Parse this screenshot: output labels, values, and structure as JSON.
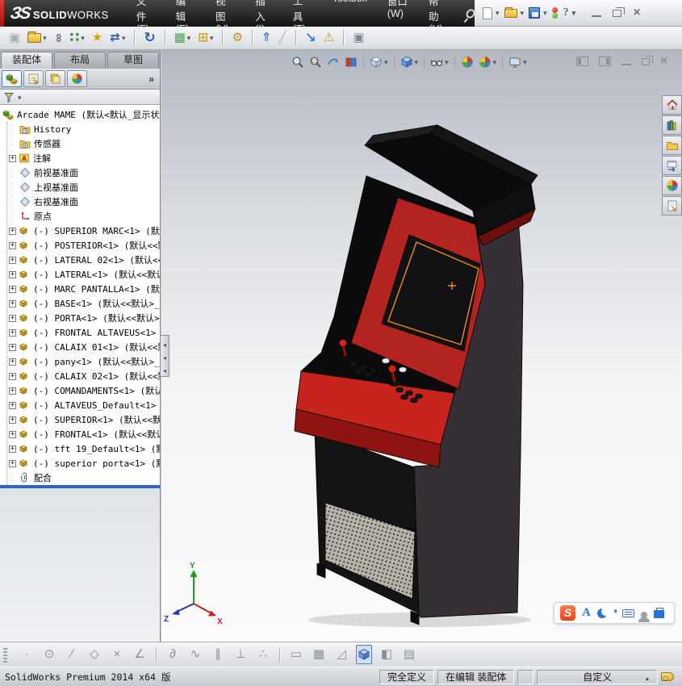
{
  "window": {
    "brand_mark": "ЗS",
    "brand_solid": "SOLID",
    "brand_works": "WORKS",
    "menus": [
      "文件(F)",
      "编辑(E)",
      "视图(V)",
      "插入(I)",
      "工具(T)",
      "Toolbox",
      "窗口(W)",
      "帮助(H)"
    ]
  },
  "toolbar": {
    "icons": [
      "insert-component",
      "open-document",
      "mate",
      "linear-component-pattern",
      "smart-fasteners",
      "move-component",
      "rotate-component",
      "show-hidden-components",
      "assembly-features",
      "new-motion-study",
      "exploded-view",
      "explode-line-sketch",
      "large-design-review",
      "instant3d-warning",
      "preview-window"
    ]
  },
  "left_panel": {
    "tabs": [
      "装配体",
      "布局",
      "草图"
    ],
    "active_tab": "装配体",
    "manager_tabs": [
      "featuremanager-design-tree",
      "propertymanager",
      "configurationmanager",
      "displaymanager"
    ],
    "overflow_glyph": "»",
    "tree": {
      "root_label": "Arcade MAME  (默认<默认_显示状",
      "items": [
        {
          "label": "History"
        },
        {
          "label": "传感器"
        },
        {
          "label": "注解"
        },
        {
          "label": "前视基准面"
        },
        {
          "label": "上视基准面"
        },
        {
          "label": "右视基准面"
        },
        {
          "label": "原点"
        },
        {
          "label": "(-) SUPERIOR MARC<1> (默认"
        },
        {
          "label": "(-) POSTERIOR<1> (默认<<默"
        },
        {
          "label": "(-) LATERAL 02<1> (默认<<默"
        },
        {
          "label": "(-) LATERAL<1> (默认<<默认"
        },
        {
          "label": "(-) MARC PANTALLA<1> (默认"
        },
        {
          "label": "(-) BASE<1> (默认<<默认>_"
        },
        {
          "label": "(-) PORTA<1> (默认<<默认>_"
        },
        {
          "label": "(-) FRONTAL ALTAVEUS<1> (默"
        },
        {
          "label": "(-) CALAIX 01<1> (默认<<默"
        },
        {
          "label": "(-) pany<1> (默认<<默认>_"
        },
        {
          "label": "(-) CALAIX 02<1> (默认<<默"
        },
        {
          "label": "(-) COMANDAMENTS<1> (默认"
        },
        {
          "label": "(-) ALTAVEUS_Default<1> (默"
        },
        {
          "label": "(-) SUPERIOR<1> (默认<<默"
        },
        {
          "label": "(-) FRONTAL<1> (默认<<默认"
        },
        {
          "label": "(-) tft 19_Default<1> (默"
        },
        {
          "label": "(-) superior porta<1> (默"
        },
        {
          "label": "配合"
        }
      ]
    }
  },
  "viewport": {
    "hud_icons": [
      "zoom-to-fit",
      "zoom-to-area",
      "previous-view",
      "section-view",
      "view-orientation",
      "display-style",
      "hide-show-items",
      "edit-appearance",
      "apply-scene",
      "view-settings"
    ],
    "doc_controls": [
      "pane-left",
      "pane-right",
      "minimize",
      "restore",
      "close"
    ],
    "task_pane": [
      "home",
      "solidworks-resources",
      "design-library",
      "file-explorer",
      "appearances-scenes",
      "custom-properties"
    ],
    "triad": {
      "x": "X",
      "y": "Y",
      "z": "Z"
    },
    "ime": {
      "logo": "S",
      "letter": "A",
      "quote": "’’"
    }
  },
  "statusbar": {
    "product": "SolidWorks Premium 2014 x64 版",
    "define_state": "完全定义",
    "edit_state": "在编辑 装配体",
    "custom": "自定义"
  },
  "colors": {
    "accent_red": "#d6201c",
    "cabinet_body": "#362f35",
    "cabinet_black": "#0b0b0d",
    "bezel_red": "#b32420",
    "panel_red": "#c6241c",
    "panel_red_dark": "#8f1410",
    "screen_black": "#121214",
    "selection_orange": "#ef8c1f",
    "grille": "#b7b3ab"
  }
}
